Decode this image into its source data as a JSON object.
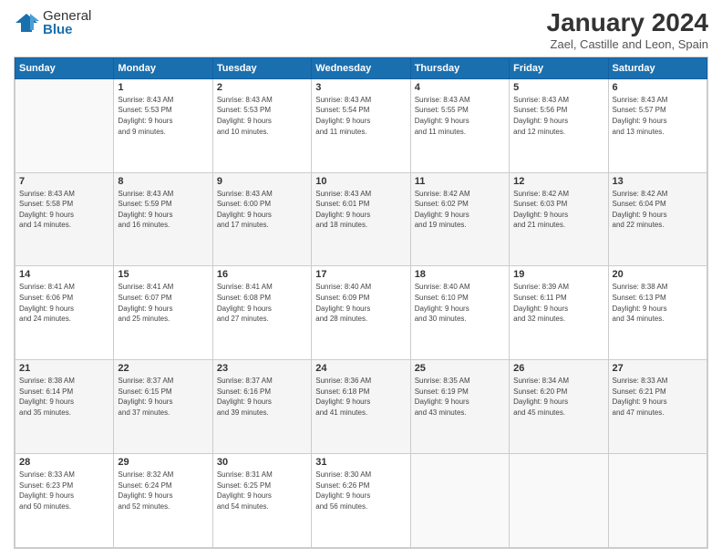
{
  "logo": {
    "general": "General",
    "blue": "Blue"
  },
  "header": {
    "title": "January 2024",
    "subtitle": "Zael, Castille and Leon, Spain"
  },
  "calendar": {
    "days": [
      "Sunday",
      "Monday",
      "Tuesday",
      "Wednesday",
      "Thursday",
      "Friday",
      "Saturday"
    ],
    "weeks": [
      [
        {
          "day": "",
          "content": ""
        },
        {
          "day": "1",
          "content": "Sunrise: 8:43 AM\nSunset: 5:53 PM\nDaylight: 9 hours\nand 9 minutes."
        },
        {
          "day": "2",
          "content": "Sunrise: 8:43 AM\nSunset: 5:53 PM\nDaylight: 9 hours\nand 10 minutes."
        },
        {
          "day": "3",
          "content": "Sunrise: 8:43 AM\nSunset: 5:54 PM\nDaylight: 9 hours\nand 11 minutes."
        },
        {
          "day": "4",
          "content": "Sunrise: 8:43 AM\nSunset: 5:55 PM\nDaylight: 9 hours\nand 11 minutes."
        },
        {
          "day": "5",
          "content": "Sunrise: 8:43 AM\nSunset: 5:56 PM\nDaylight: 9 hours\nand 12 minutes."
        },
        {
          "day": "6",
          "content": "Sunrise: 8:43 AM\nSunset: 5:57 PM\nDaylight: 9 hours\nand 13 minutes."
        }
      ],
      [
        {
          "day": "7",
          "content": "Sunrise: 8:43 AM\nSunset: 5:58 PM\nDaylight: 9 hours\nand 14 minutes."
        },
        {
          "day": "8",
          "content": "Sunrise: 8:43 AM\nSunset: 5:59 PM\nDaylight: 9 hours\nand 16 minutes."
        },
        {
          "day": "9",
          "content": "Sunrise: 8:43 AM\nSunset: 6:00 PM\nDaylight: 9 hours\nand 17 minutes."
        },
        {
          "day": "10",
          "content": "Sunrise: 8:43 AM\nSunset: 6:01 PM\nDaylight: 9 hours\nand 18 minutes."
        },
        {
          "day": "11",
          "content": "Sunrise: 8:42 AM\nSunset: 6:02 PM\nDaylight: 9 hours\nand 19 minutes."
        },
        {
          "day": "12",
          "content": "Sunrise: 8:42 AM\nSunset: 6:03 PM\nDaylight: 9 hours\nand 21 minutes."
        },
        {
          "day": "13",
          "content": "Sunrise: 8:42 AM\nSunset: 6:04 PM\nDaylight: 9 hours\nand 22 minutes."
        }
      ],
      [
        {
          "day": "14",
          "content": "Sunrise: 8:41 AM\nSunset: 6:06 PM\nDaylight: 9 hours\nand 24 minutes."
        },
        {
          "day": "15",
          "content": "Sunrise: 8:41 AM\nSunset: 6:07 PM\nDaylight: 9 hours\nand 25 minutes."
        },
        {
          "day": "16",
          "content": "Sunrise: 8:41 AM\nSunset: 6:08 PM\nDaylight: 9 hours\nand 27 minutes."
        },
        {
          "day": "17",
          "content": "Sunrise: 8:40 AM\nSunset: 6:09 PM\nDaylight: 9 hours\nand 28 minutes."
        },
        {
          "day": "18",
          "content": "Sunrise: 8:40 AM\nSunset: 6:10 PM\nDaylight: 9 hours\nand 30 minutes."
        },
        {
          "day": "19",
          "content": "Sunrise: 8:39 AM\nSunset: 6:11 PM\nDaylight: 9 hours\nand 32 minutes."
        },
        {
          "day": "20",
          "content": "Sunrise: 8:38 AM\nSunset: 6:13 PM\nDaylight: 9 hours\nand 34 minutes."
        }
      ],
      [
        {
          "day": "21",
          "content": "Sunrise: 8:38 AM\nSunset: 6:14 PM\nDaylight: 9 hours\nand 35 minutes."
        },
        {
          "day": "22",
          "content": "Sunrise: 8:37 AM\nSunset: 6:15 PM\nDaylight: 9 hours\nand 37 minutes."
        },
        {
          "day": "23",
          "content": "Sunrise: 8:37 AM\nSunset: 6:16 PM\nDaylight: 9 hours\nand 39 minutes."
        },
        {
          "day": "24",
          "content": "Sunrise: 8:36 AM\nSunset: 6:18 PM\nDaylight: 9 hours\nand 41 minutes."
        },
        {
          "day": "25",
          "content": "Sunrise: 8:35 AM\nSunset: 6:19 PM\nDaylight: 9 hours\nand 43 minutes."
        },
        {
          "day": "26",
          "content": "Sunrise: 8:34 AM\nSunset: 6:20 PM\nDaylight: 9 hours\nand 45 minutes."
        },
        {
          "day": "27",
          "content": "Sunrise: 8:33 AM\nSunset: 6:21 PM\nDaylight: 9 hours\nand 47 minutes."
        }
      ],
      [
        {
          "day": "28",
          "content": "Sunrise: 8:33 AM\nSunset: 6:23 PM\nDaylight: 9 hours\nand 50 minutes."
        },
        {
          "day": "29",
          "content": "Sunrise: 8:32 AM\nSunset: 6:24 PM\nDaylight: 9 hours\nand 52 minutes."
        },
        {
          "day": "30",
          "content": "Sunrise: 8:31 AM\nSunset: 6:25 PM\nDaylight: 9 hours\nand 54 minutes."
        },
        {
          "day": "31",
          "content": "Sunrise: 8:30 AM\nSunset: 6:26 PM\nDaylight: 9 hours\nand 56 minutes."
        },
        {
          "day": "",
          "content": ""
        },
        {
          "day": "",
          "content": ""
        },
        {
          "day": "",
          "content": ""
        }
      ]
    ]
  }
}
